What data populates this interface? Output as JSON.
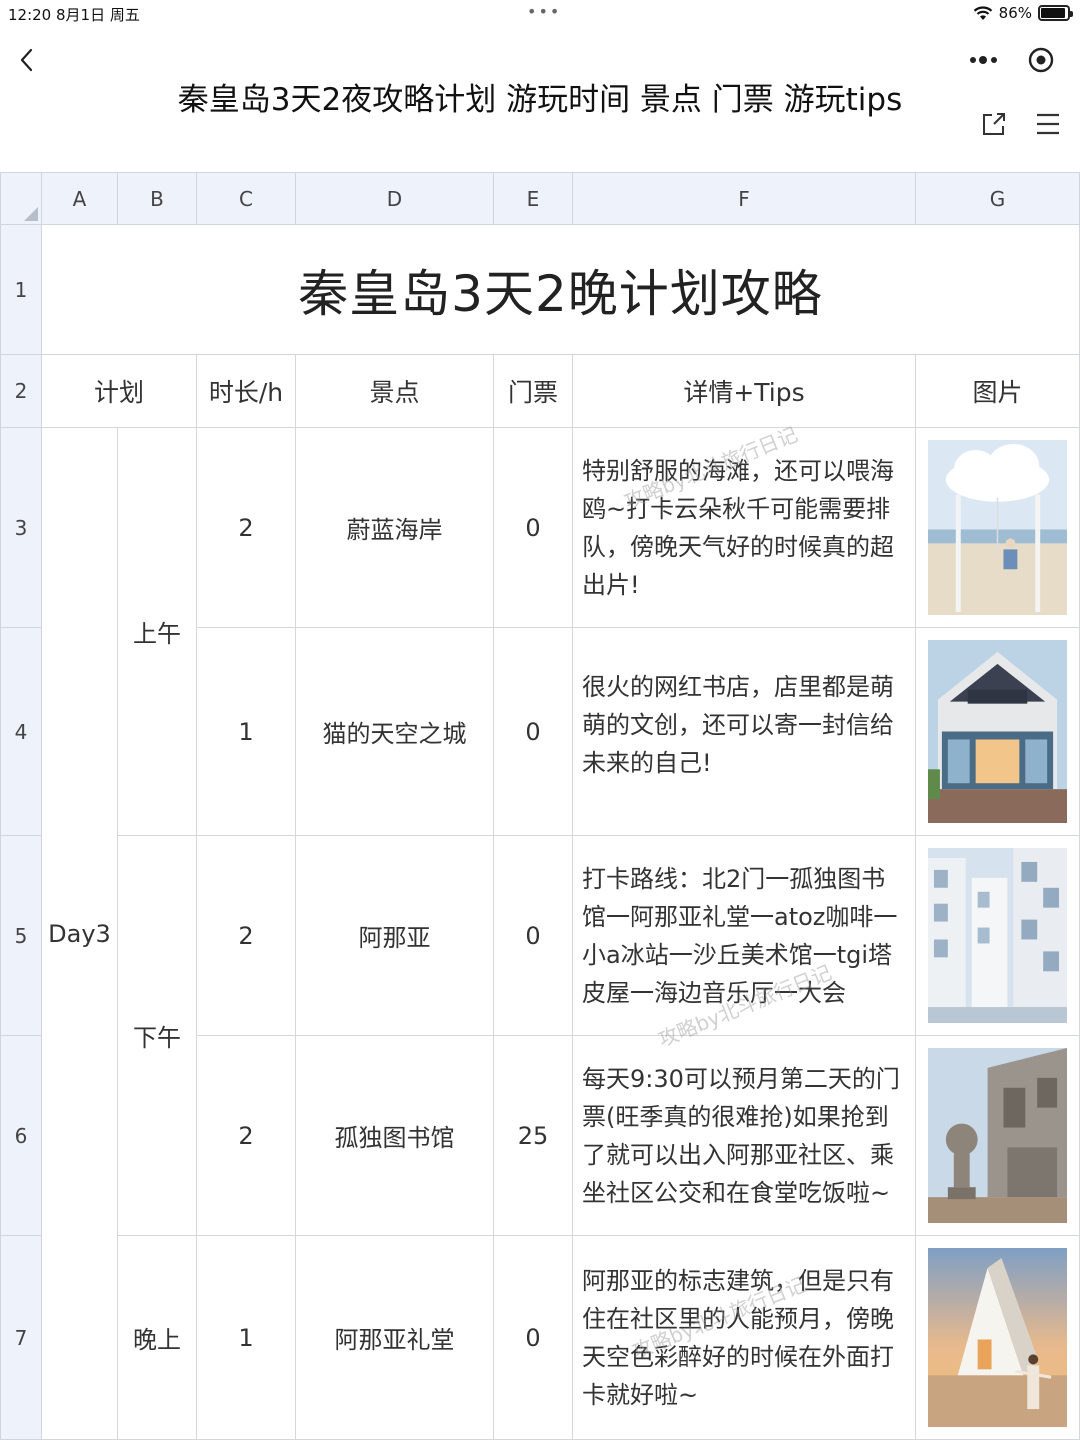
{
  "status_bar": {
    "time": "12:20 8月1日 周五",
    "dots": "•••",
    "battery": "86%"
  },
  "header": {
    "title": "秦皇岛3天2夜攻略计划 游玩时间 景点 门票 游玩tips"
  },
  "columns": [
    "A",
    "B",
    "C",
    "D",
    "E",
    "F",
    "G"
  ],
  "row_numbers": [
    "1",
    "2",
    "3",
    "4",
    "5",
    "6",
    "7"
  ],
  "sheet": {
    "title": "秦皇岛3天2晚计划攻略",
    "headers": {
      "plan": "计划",
      "duration": "时长/h",
      "spot": "景点",
      "ticket": "门票",
      "details": "详情+Tips",
      "picture": "图片"
    },
    "day": "Day3",
    "periods": {
      "morning": "上午",
      "afternoon": "下午",
      "evening": "晚上"
    },
    "rows": [
      {
        "duration": "2",
        "spot": "蔚蓝海岸",
        "ticket": "0",
        "tips": "特别舒服的海滩，还可以喂海鸥~打卡云朵秋千可能需要排队，傍晚天气好的时候真的超出片!"
      },
      {
        "duration": "1",
        "spot": "猫的天空之城",
        "ticket": "0",
        "tips": "很火的网红书店，店里都是萌萌的文创，还可以寄一封信给未来的自己!"
      },
      {
        "duration": "2",
        "spot": "阿那亚",
        "ticket": "0",
        "tips": "打卡路线：北2门一孤独图书馆一阿那亚礼堂一atoz咖啡一小a冰站一沙丘美术馆一tgi塔皮屋一海边音乐厅一大会"
      },
      {
        "duration": "2",
        "spot": "孤独图书馆",
        "ticket": "25",
        "tips": "每天9:30可以预月第二天的门票(旺季真的很难抢)如果抢到了就可以出入阿那亚社区、乘坐社区公交和在食堂吃饭啦~"
      },
      {
        "duration": "1",
        "spot": "阿那亚礼堂",
        "ticket": "0",
        "tips": "阿那亚的标志建筑，但是只有住在社区里的人能预月，傍晚天空色彩醉好的时候在外面打卡就好啦~"
      }
    ]
  },
  "watermarks": [
    "攻略by北斗旅行日记",
    "攻略by北斗旅行日记",
    "攻略by北斗旅行日记"
  ]
}
